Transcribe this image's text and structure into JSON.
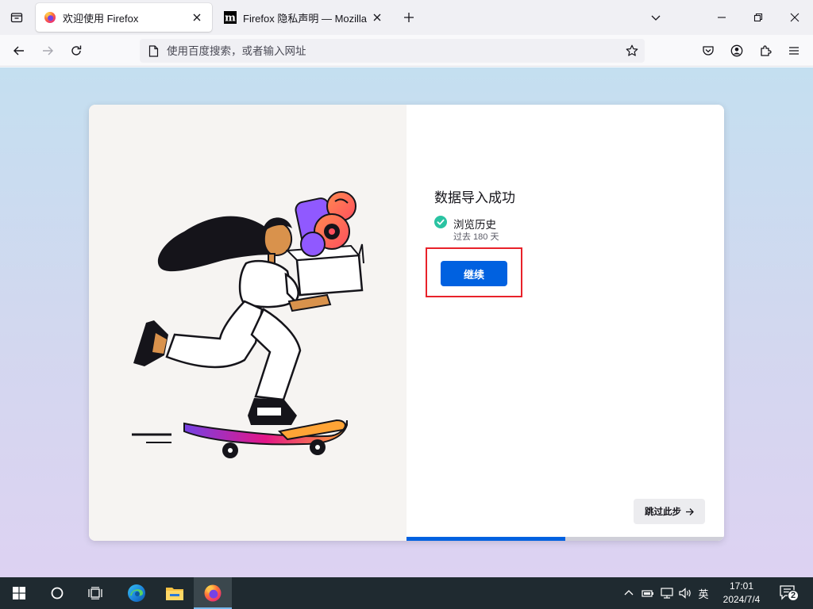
{
  "browser": {
    "tabs": [
      {
        "title": "欢迎使用 Firefox",
        "active": true,
        "icon": "firefox-icon"
      },
      {
        "title": "Firefox 隐私声明 — Mozilla",
        "active": false,
        "icon": "mozilla-m-icon"
      }
    ],
    "urlbar": {
      "placeholder": "使用百度搜索，或者输入网址",
      "value": ""
    }
  },
  "onboarding": {
    "title": "数据导入成功",
    "items": [
      {
        "label": "浏览历史",
        "sublabel": "过去 180 天",
        "icon": "check-circle-icon"
      }
    ],
    "continue_label": "继续",
    "skip_label": "跳过此步",
    "progress_fraction": 0.5
  },
  "taskbar": {
    "apps": [
      "edge-icon",
      "file-explorer-icon",
      "firefox-icon"
    ],
    "ime_label": "英",
    "clock_time": "17:01",
    "clock_date": "2024/7/4",
    "notification_count": "2"
  },
  "colors": {
    "accent_blue": "#0061e0",
    "highlight_red": "#e8222a",
    "check_green": "#2ac3a2"
  }
}
